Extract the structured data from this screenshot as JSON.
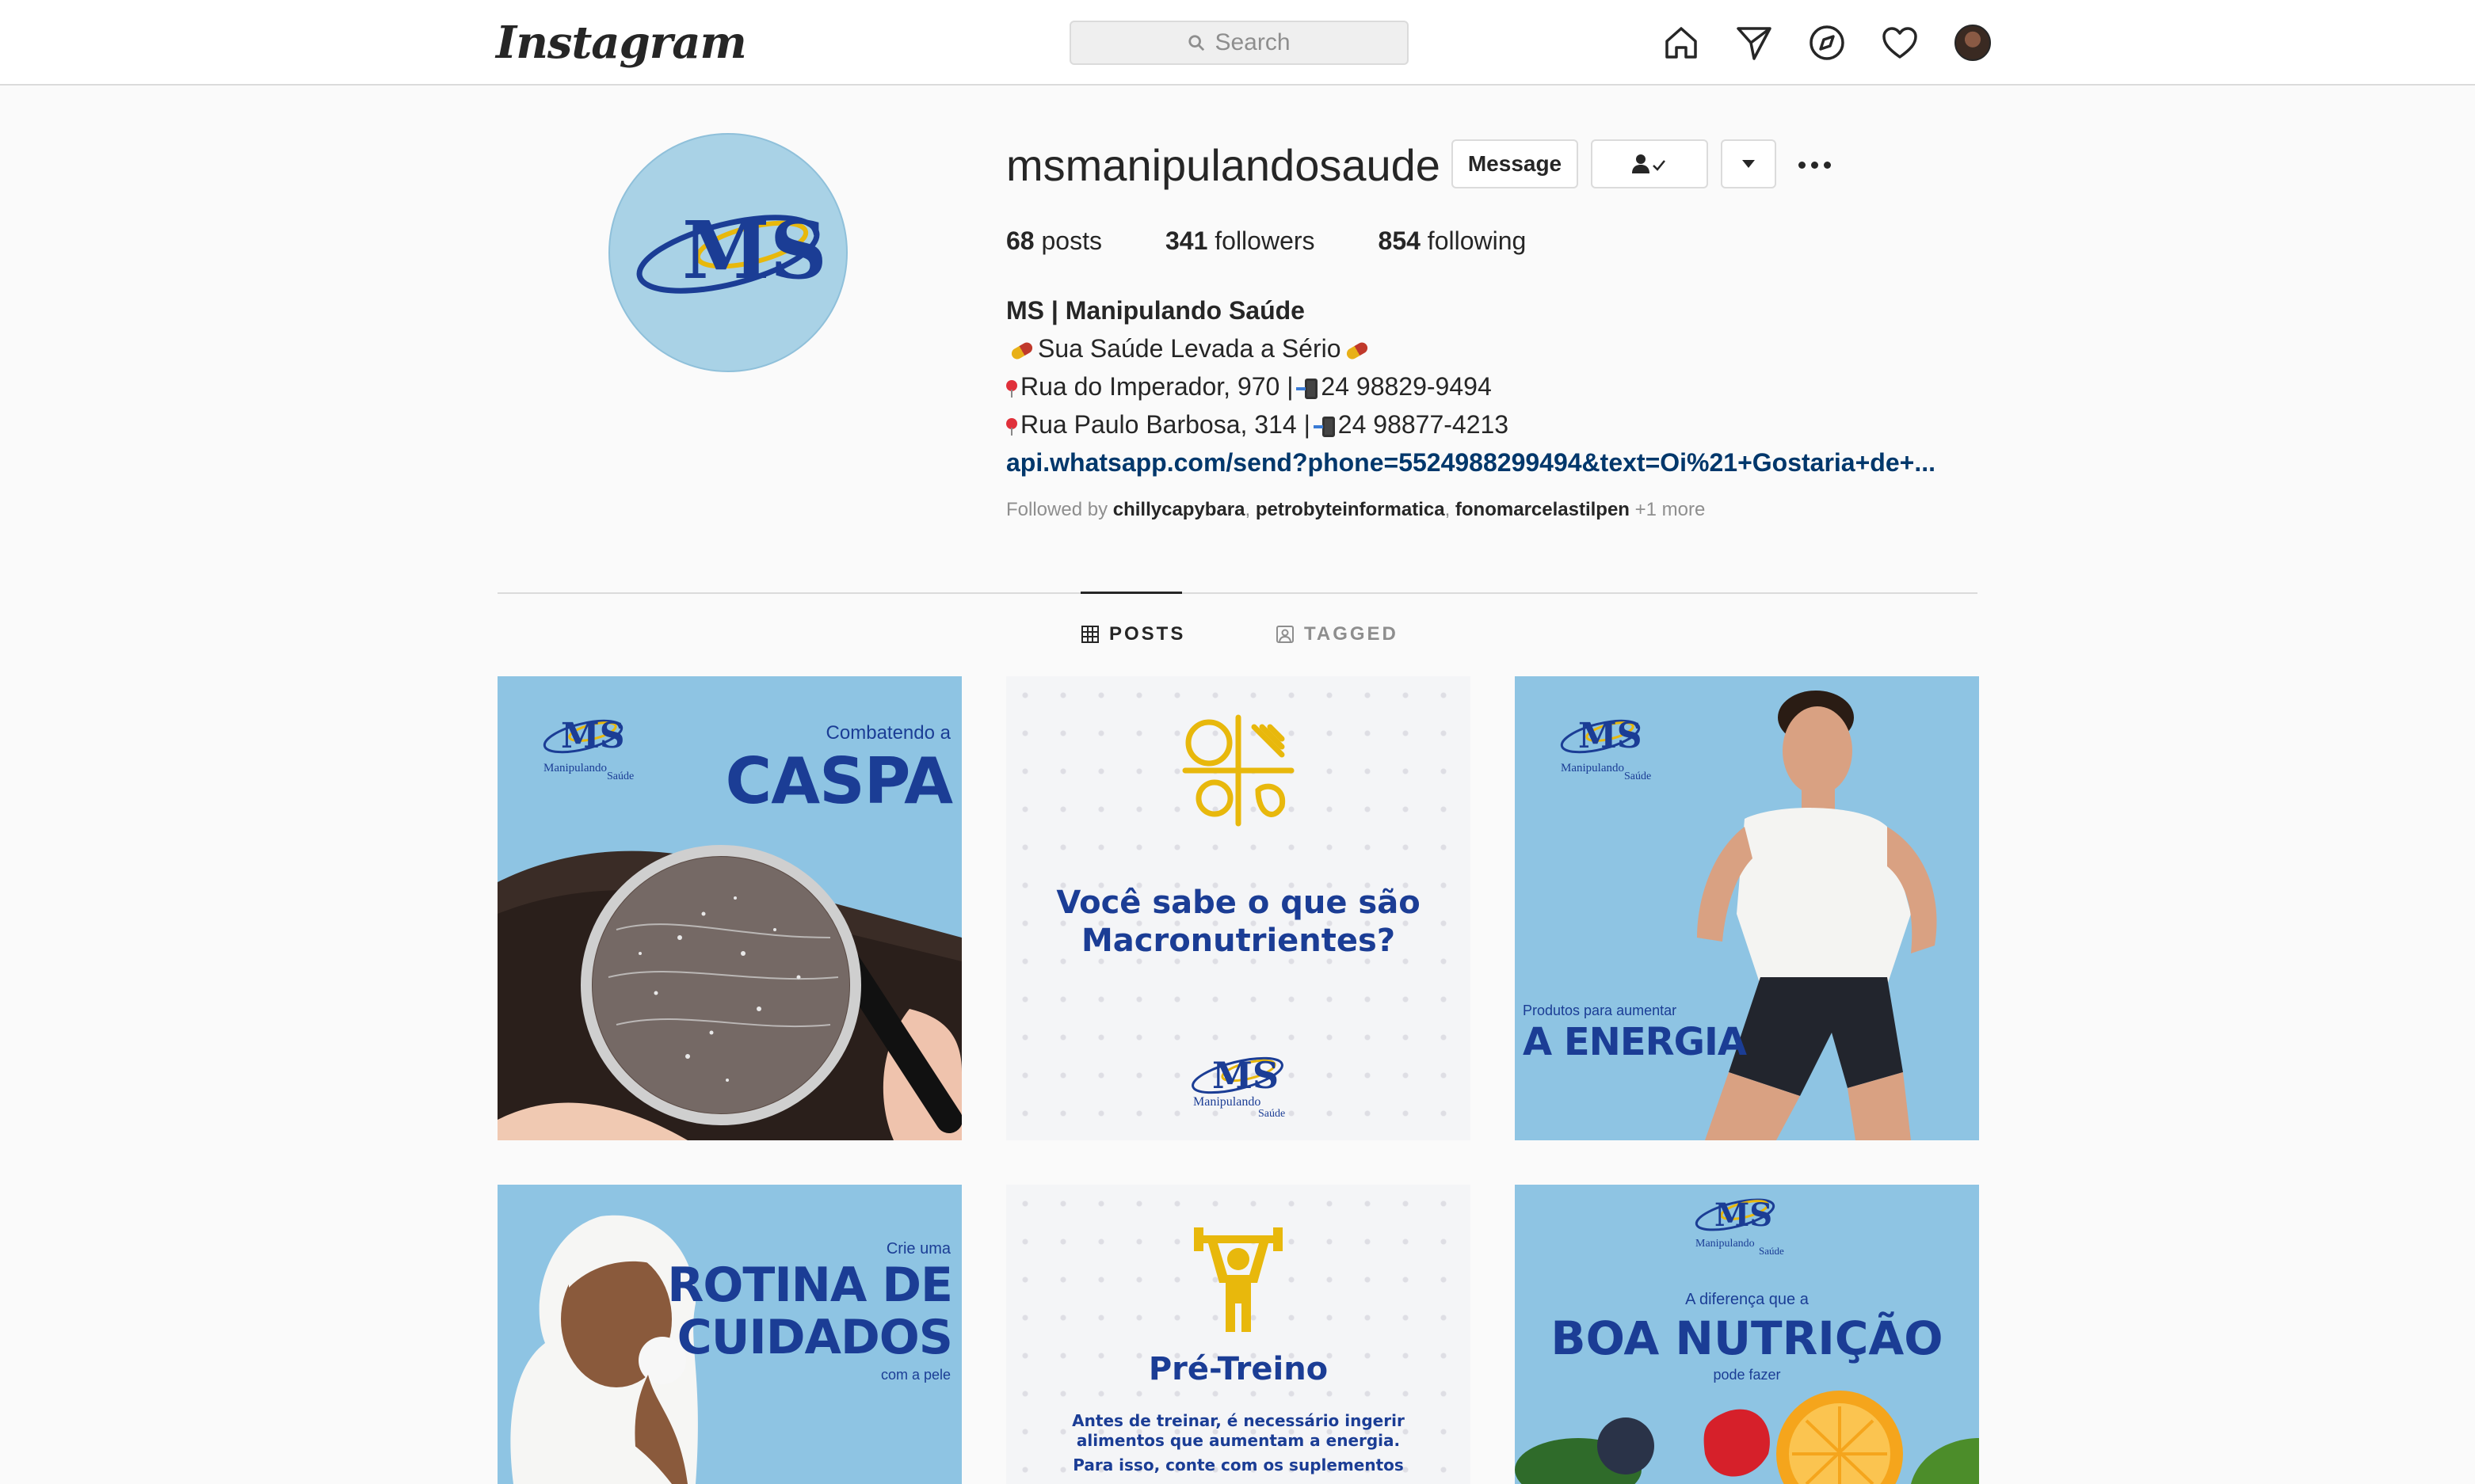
{
  "header": {
    "logo": "Instagram",
    "search_placeholder": "Search"
  },
  "profile": {
    "username": "msmanipulandosaude",
    "message_label": "Message",
    "stats": [
      {
        "count": "68",
        "label": "posts"
      },
      {
        "count": "341",
        "label": "followers"
      },
      {
        "count": "854",
        "label": "following"
      }
    ],
    "bio": {
      "name": "MS | Manipulando Saúde",
      "tagline": "Sua Saúde Levada a Sério",
      "address1": "Rua do Imperador, 970 | ",
      "phone1": "24 98829-9494",
      "address2": "Rua Paulo Barbosa, 314 | ",
      "phone2": "24 98877-4213",
      "link": "api.whatsapp.com/send?phone=5524988299494&text=Oi%21+Gostaria+de+..."
    },
    "followed_by": {
      "prefix": "Followed by",
      "users": [
        "chillycapybara",
        "petrobyteinformatica",
        "fonomarcelastilpen"
      ],
      "more": "+1 more"
    }
  },
  "tabs": [
    {
      "label": "POSTS",
      "active": true
    },
    {
      "label": "TAGGED",
      "active": false
    }
  ],
  "posts": [
    {
      "line1": "Combatendo a",
      "line2": "CASPA"
    },
    {
      "line1": "Você sabe o que são",
      "line2": "Macronutrientes?"
    },
    {
      "line1": "Produtos para aumentar",
      "line2": "A ENERGIA"
    },
    {
      "line1": "Crie uma",
      "line2": "ROTINA DE",
      "line3": "CUIDADOS",
      "line4": "com a pele"
    },
    {
      "line1": "Pré-Treino",
      "line2": "Antes de treinar, é necessário ingerir",
      "line3": "alimentos que aumentam a energia.",
      "line4": "Para isso, conte com os suplementos"
    },
    {
      "line1": "A diferença que a",
      "line2": "BOA NUTRIÇÃO",
      "line3": "pode fazer"
    }
  ],
  "brand": {
    "logo_text": "MS",
    "logo_sub1": "Manipulando",
    "logo_sub2": "Saúde",
    "blue": "#1b3d95",
    "gold": "#e8b80c",
    "light_blue": "#8ec4e3"
  }
}
